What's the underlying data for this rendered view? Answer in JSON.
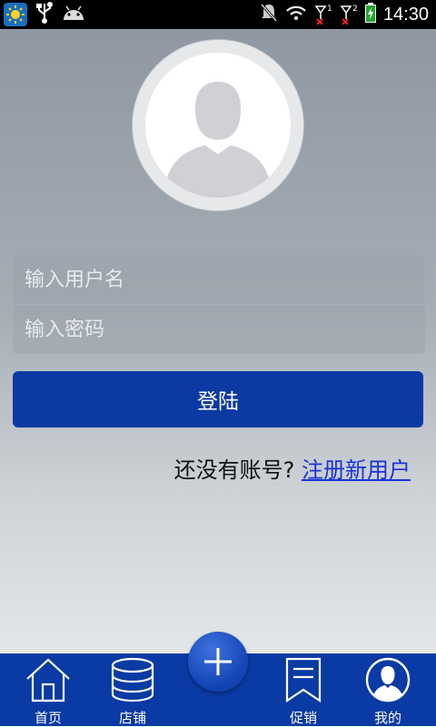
{
  "status_bar": {
    "time": "14:30",
    "sim1_label": "1",
    "sim2_label": "2",
    "left_icons": [
      "weather-icon",
      "usb-icon",
      "android-debug-icon"
    ],
    "right_icons": [
      "notifications-muted-icon",
      "wifi-icon",
      "signal-sim1-icon",
      "signal-sim2-icon",
      "battery-charging-icon"
    ]
  },
  "login": {
    "username_placeholder": "输入用户名",
    "password_placeholder": "输入密码",
    "login_label": "登陆",
    "register_prompt": "还没有账号?",
    "register_link": "注册新用户"
  },
  "nav": {
    "items": [
      {
        "label": "首页",
        "icon": "home-icon"
      },
      {
        "label": "店铺",
        "icon": "database-icon"
      },
      {
        "label": "促销",
        "icon": "bookmark-icon"
      },
      {
        "label": "我的",
        "icon": "user-icon"
      }
    ],
    "fab_icon": "plus-icon"
  },
  "colors": {
    "primary": "#0c3aa2",
    "nav_background": "#0a3aa3",
    "link": "#1a33d4",
    "status_bar": "#000000"
  }
}
